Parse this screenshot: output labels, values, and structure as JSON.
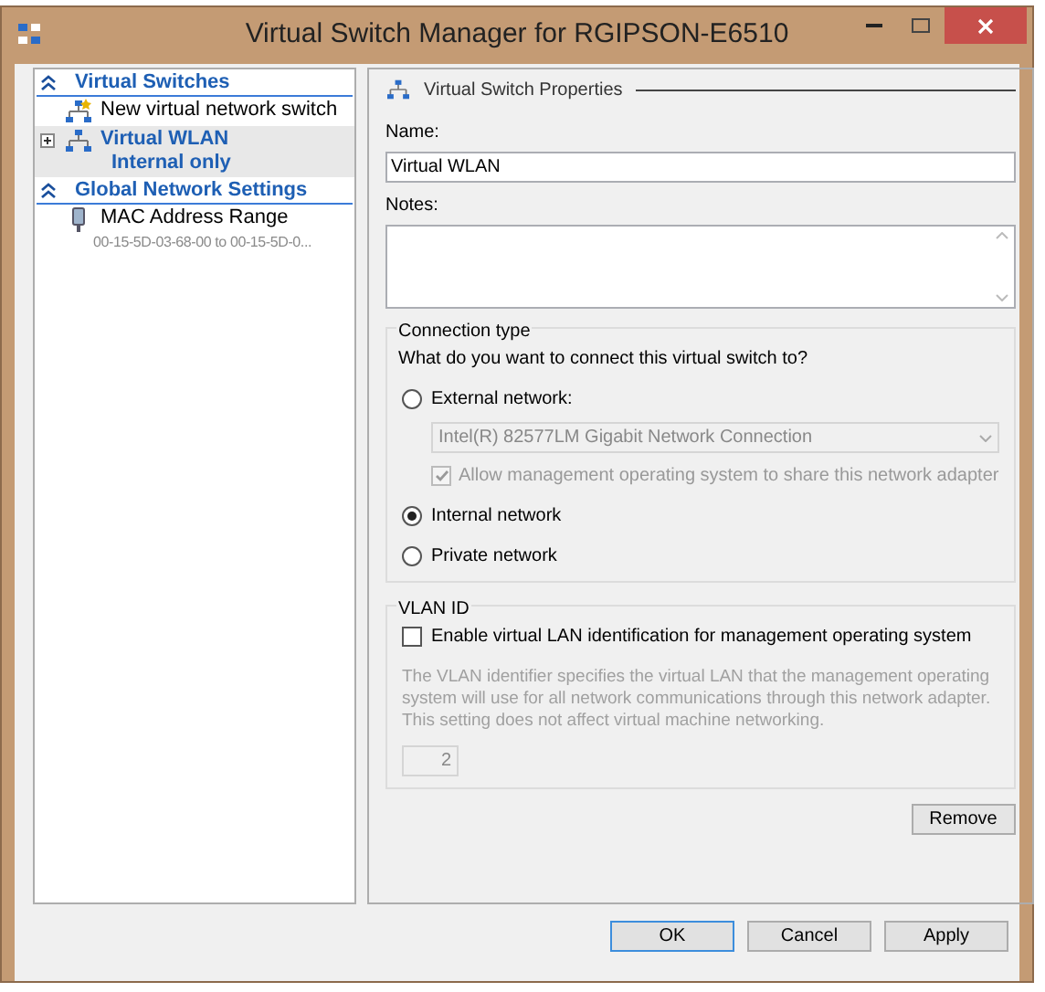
{
  "window": {
    "title": "Virtual Switch Manager for RGIPSON-E6510"
  },
  "sidebar": {
    "sections": [
      {
        "title": "Virtual Switches",
        "expanded": true,
        "items": [
          {
            "kind": "action",
            "label": "New virtual network switch",
            "selected": false
          },
          {
            "kind": "switch",
            "label": "Virtual WLAN",
            "sublabel": "Internal only",
            "selected": true,
            "expanded": false
          }
        ]
      },
      {
        "title": "Global Network Settings",
        "expanded": true,
        "items": [
          {
            "kind": "setting",
            "label": "MAC Address Range",
            "sublabel": "00-15-5D-03-68-00 to 00-15-5D-0...",
            "selected": false
          }
        ]
      }
    ]
  },
  "properties": {
    "header": "Virtual Switch Properties",
    "name_label": "Name:",
    "name_value": "Virtual WLAN",
    "notes_label": "Notes:",
    "connection_type": {
      "title": "Connection type",
      "question": "What do you want to connect this virtual switch to?",
      "options": [
        {
          "label": "External network:",
          "selected": false,
          "adapter": {
            "value": "Intel(R) 82577LM Gigabit Network Connection",
            "disabled": true
          },
          "share": {
            "label": "Allow management operating system to share this network adapter",
            "checked": true,
            "disabled": true
          }
        },
        {
          "label": "Internal network",
          "selected": true
        },
        {
          "label": "Private network",
          "selected": false
        }
      ]
    },
    "vlan": {
      "title": "VLAN ID",
      "checkbox": {
        "label": "Enable virtual LAN identification for management operating system",
        "checked": false
      },
      "description": "The VLAN identifier specifies the virtual LAN that the management operating system will use for all network communications through this network adapter. This setting does not affect virtual machine networking.",
      "value": "2",
      "disabled": true
    },
    "remove_button": "Remove"
  },
  "buttons": [
    {
      "label": "OK",
      "default": true
    },
    {
      "label": "Cancel",
      "default": false
    },
    {
      "label": "Apply",
      "default": false
    }
  ]
}
